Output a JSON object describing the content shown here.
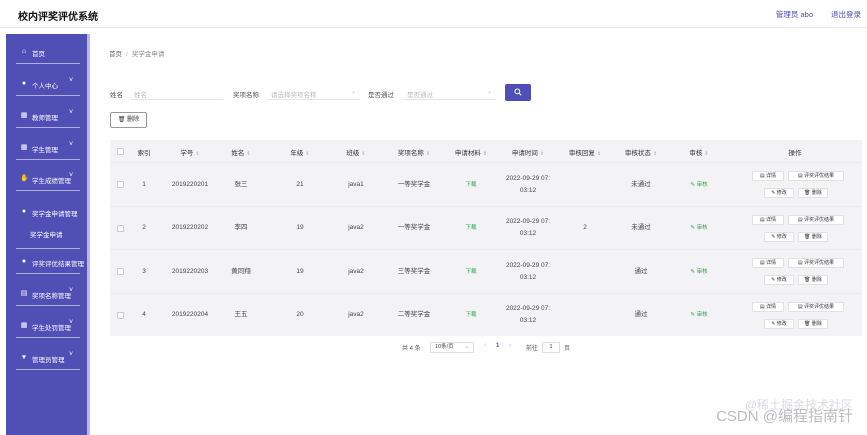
{
  "header": {
    "app_title": "校内评奖评优系统",
    "user_label": "管理员 abo",
    "logout_label": "退出登录"
  },
  "sidebar": {
    "items": [
      {
        "label": "首页",
        "icon": "home-icon",
        "chevron": ""
      },
      {
        "label": "个人中心",
        "icon": "user-icon",
        "chevron": "˅"
      },
      {
        "label": "教师管理",
        "icon": "grid-icon",
        "chevron": "˅"
      },
      {
        "label": "学生管理",
        "icon": "grid-icon",
        "chevron": "˅"
      },
      {
        "label": "学生成绩管理",
        "icon": "thumb-icon",
        "chevron": "˅"
      },
      {
        "label": "奖学金申请管理",
        "icon": "user-icon",
        "chevron": ""
      },
      {
        "label": "评奖评优结果管理",
        "icon": "user-icon",
        "chevron": ""
      },
      {
        "label": "奖项名称管理",
        "icon": "list-icon",
        "chevron": "˅"
      },
      {
        "label": "学生处罚管理",
        "icon": "grid-icon",
        "chevron": "˅"
      },
      {
        "label": "管理员管理",
        "icon": "heart-icon",
        "chevron": "˅"
      }
    ],
    "sub_item": "奖学金申请"
  },
  "breadcrumb": {
    "home": "首页",
    "separator": "/",
    "current": "奖学金申请"
  },
  "filters": {
    "name_label": "姓名",
    "name_placeholder": "姓名",
    "award_label": "奖项名称",
    "award_placeholder": "请选择奖项名称",
    "passed_label": "是否通过",
    "passed_placeholder": "是否通过"
  },
  "toolbar": {
    "delete_label": "删除"
  },
  "table": {
    "headers": [
      "索引",
      "学号",
      "姓名",
      "年级",
      "班级",
      "奖项名称",
      "申请材料",
      "申请时间",
      "审核回复",
      "审核状态",
      "审核",
      "操作"
    ],
    "rows": [
      {
        "index": "1",
        "student_id": "2019220201",
        "name": "张三",
        "grade": "21",
        "class": "java1",
        "award": "一等奖学金",
        "material": "下载",
        "time_date": "2022-09-29 07:",
        "time_clock": "03:12",
        "reply": "",
        "status": "未通过",
        "audit": "审核"
      },
      {
        "index": "2",
        "student_id": "2019220202",
        "name": "李四",
        "grade": "19",
        "class": "java2",
        "award": "一等奖学金",
        "material": "下载",
        "time_date": "2022-09-29 07:",
        "time_clock": "03:12",
        "reply": "2",
        "status": "未通过",
        "audit": "审核"
      },
      {
        "index": "3",
        "student_id": "2019220203",
        "name": "黄同翔",
        "grade": "19",
        "class": "java2",
        "award": "三等奖学金",
        "material": "下载",
        "time_date": "2022-09-29 07:",
        "time_clock": "03:12",
        "reply": "",
        "status": "通过",
        "audit": "审核"
      },
      {
        "index": "4",
        "student_id": "2019220204",
        "name": "王五",
        "grade": "20",
        "class": "java2",
        "award": "二等奖学金",
        "material": "下载",
        "time_date": "2022-09-29 07:",
        "time_clock": "03:12",
        "reply": "",
        "status": "通过",
        "audit": "审核"
      }
    ],
    "actions": {
      "detail": "详情",
      "result": "评奖评优结果",
      "edit": "修改",
      "delete": "删除"
    }
  },
  "pagination": {
    "total": "共 4 条",
    "page_size": "10条/页",
    "current_page": "1",
    "goto_label": "前往",
    "goto_value": "1",
    "page_suffix": "页"
  },
  "watermark": {
    "line1": "@稀土掘金技术社区",
    "line2": "CSDN @编程指南针"
  },
  "colors": {
    "sidebar_bg": "#4f4fb5",
    "accent": "#4f4fb5",
    "success": "#2aa34a"
  }
}
